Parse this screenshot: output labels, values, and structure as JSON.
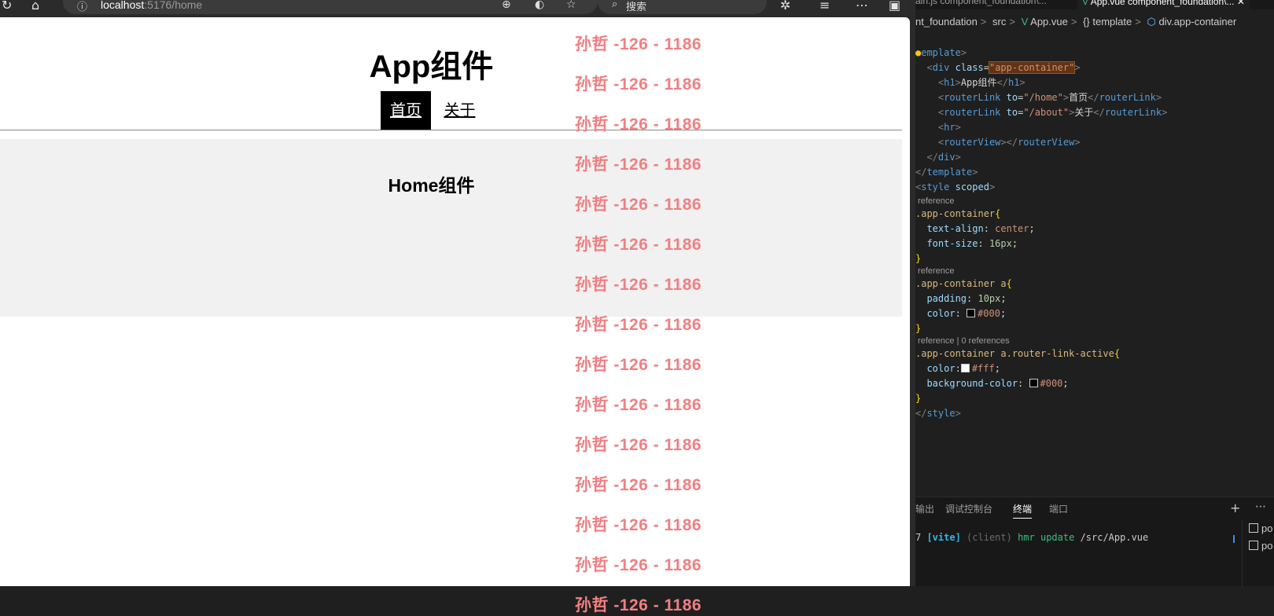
{
  "browser": {
    "back_icon": "refresh-icon",
    "home_icon": "home-icon",
    "url_host": "localhost",
    "url_rest": ":5176/home",
    "search_placeholder": "搜索",
    "icons": [
      "info-icon",
      "zoom-icon",
      "edge-icon",
      "favorite-icon",
      "extensions-icon",
      "favorites-bar-icon",
      "more-icon",
      "sidebar-icon"
    ]
  },
  "app": {
    "title": "App组件",
    "nav": [
      {
        "label": "首页",
        "active": true
      },
      {
        "label": "关于",
        "active": false
      }
    ],
    "home_title": "Home组件"
  },
  "watermark": {
    "text": "孙哲 -126 - 1186",
    "color": "#f07f82",
    "count": 15
  },
  "editor": {
    "tabs": [
      {
        "label": "ain.js component_foundation\\...",
        "active": false
      },
      {
        "label": "App.vue component_foundation\\...",
        "active": true
      }
    ],
    "close_symbol": "✕",
    "breadcrumb": [
      "nt_foundation",
      "src",
      "App.vue",
      "{} template",
      "div.app-container"
    ],
    "code": {
      "l1_tag": "emplate",
      "l2_tag": "div",
      "l2_attr": "class",
      "l2_val": "\"app-container\"",
      "l3_tag": "h1",
      "l3_text": "App组件",
      "l4_tag": "routerLink",
      "l4_attr": "to",
      "l4_val": "\"/home\"",
      "l4_text": "首页",
      "l5_tag": "routerLink",
      "l5_attr": "to",
      "l5_val": "\"/about\"",
      "l5_text": "关于",
      "l6_tag": "hr",
      "l7_tag": "routerView",
      "l8_tag": "div",
      "l9_tag": "template",
      "l10_tag": "style",
      "l10_attr": "scoped",
      "ref1": " reference",
      "sel1": ".app-container",
      "p1": "text-align",
      "v1": "center",
      "p2": "font-size",
      "v2": "16px",
      "ref2": " reference",
      "sel2": ".app-container a",
      "p3": "padding",
      "v3": "10px",
      "p4": "color",
      "v4": "#000",
      "ref3": " reference | 0 references",
      "sel3": ".app-container a.router-link-active",
      "p5": "color",
      "v5": "#fff",
      "p6": "background-color",
      "v6": "#000",
      "l_end_tag": "style"
    },
    "panel": {
      "tabs": [
        "输出",
        "调试控制台",
        "终端",
        "端口"
      ],
      "active_tab": "终端",
      "terminal_prefix": "7 ",
      "terminal_vite": "[vite]",
      "terminal_client": "(client)",
      "terminal_hmr": "hmr update",
      "terminal_path": "/src/App.vue",
      "terminal_list": [
        "po",
        "po"
      ]
    }
  }
}
